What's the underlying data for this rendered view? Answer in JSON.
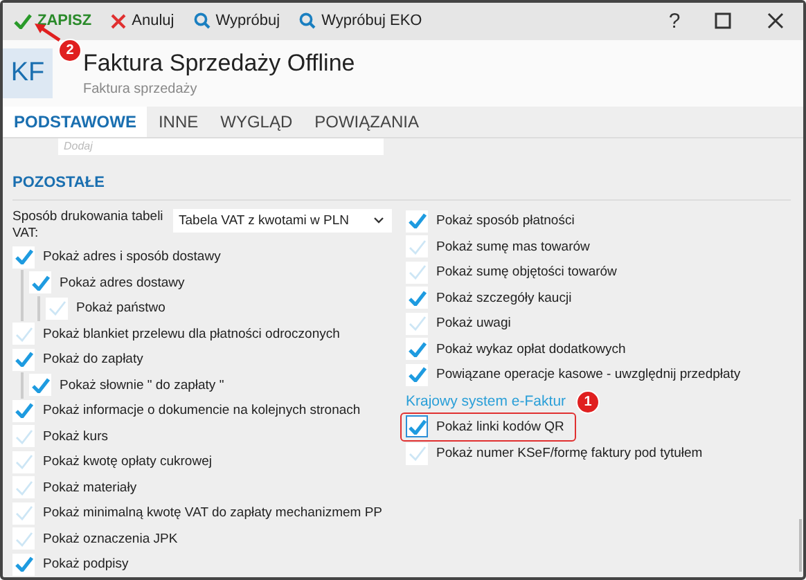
{
  "toolbar": {
    "buttons": [
      {
        "kind": "save",
        "label": "ZAPISZ"
      },
      {
        "kind": "cancel",
        "label": "Anuluj"
      },
      {
        "kind": "search",
        "label": "Wypróbuj"
      },
      {
        "kind": "search",
        "label": "Wypróbuj EKO"
      }
    ],
    "help": "?"
  },
  "header": {
    "badge": "KF",
    "title": "Faktura Sprzedaży Offline",
    "subtitle": "Faktura sprzedaży"
  },
  "tabs": [
    {
      "label": "PODSTAWOWE",
      "selected": true
    },
    {
      "label": "INNE",
      "selected": false
    },
    {
      "label": "WYGLĄD",
      "selected": false
    },
    {
      "label": "POWIĄZANIA",
      "selected": false
    }
  ],
  "top_field": {
    "placeholder": "Dodaj"
  },
  "section": {
    "title": "POZOSTAŁE"
  },
  "dropdown": {
    "label": "Sposób drukowania tabeli VAT:",
    "value": "Tabela VAT z kwotami w PLN"
  },
  "left_items": [
    {
      "label": "Pokaż adres i sposób dostawy",
      "checked": true,
      "children": [
        {
          "label": "Pokaż adres dostawy",
          "checked": true,
          "children": [
            {
              "label": "Pokaż państwo",
              "checked": false
            }
          ]
        }
      ]
    },
    {
      "label": "Pokaż blankiet przelewu dla płatności odroczonych",
      "checked": false
    },
    {
      "label": "Pokaż do zapłaty",
      "checked": true,
      "children": [
        {
          "label": "Pokaż słownie \" do zapłaty \"",
          "checked": true
        }
      ]
    },
    {
      "label": "Pokaż informacje o dokumencie na kolejnych stronach",
      "checked": true
    },
    {
      "label": "Pokaż kurs",
      "checked": false
    },
    {
      "label": "Pokaż kwotę opłaty cukrowej",
      "checked": false
    },
    {
      "label": "Pokaż materiały",
      "checked": false
    },
    {
      "label": "Pokaż minimalną kwotę VAT do zapłaty mechanizmem PP",
      "checked": false
    },
    {
      "label": "Pokaż oznaczenia JPK",
      "checked": false
    },
    {
      "label": "Pokaż podpisy",
      "checked": true
    }
  ],
  "right_items": [
    {
      "label": "Pokaż sposób płatności",
      "checked": true
    },
    {
      "label": "Pokaż sumę mas towarów",
      "checked": false
    },
    {
      "label": "Pokaż sumę objętości towarów",
      "checked": false
    },
    {
      "label": "Pokaż szczegóły kaucji",
      "checked": true
    },
    {
      "label": "Pokaż uwagi",
      "checked": false
    },
    {
      "label": "Pokaż wykaz opłat dodatkowych",
      "checked": true
    },
    {
      "label": "Powiązane operacje kasowe - uwzględnij przedpłaty",
      "checked": true
    }
  ],
  "ksef_section": {
    "title": "Krajowy system e-Faktur",
    "items": [
      {
        "label": "Pokaż linki kodów QR",
        "checked": true,
        "highlighted": true
      },
      {
        "label": "Pokaż numer KSeF/formę faktury pod tytułem",
        "checked": false,
        "highlighted": false
      }
    ]
  },
  "callouts": [
    {
      "label": "2"
    },
    {
      "label": "1"
    }
  ]
}
